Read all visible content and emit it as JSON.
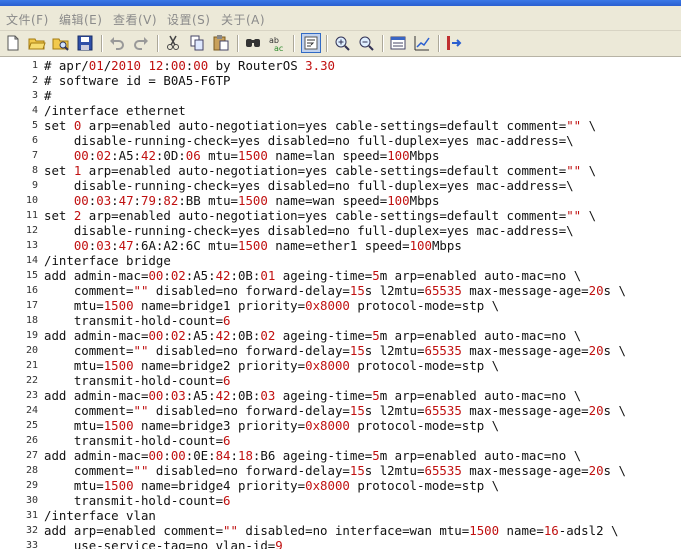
{
  "menu": {
    "items": [
      {
        "label": "文件(F)",
        "name": "menu-file"
      },
      {
        "label": "编辑(E)",
        "name": "menu-edit"
      },
      {
        "label": "查看(V)",
        "name": "menu-view"
      },
      {
        "label": "设置(S)",
        "name": "menu-settings"
      },
      {
        "label": "关于(A)",
        "name": "menu-about"
      }
    ]
  },
  "toolbar": {
    "icons": [
      "new-file-icon",
      "open-folder-icon",
      "browse-icon",
      "save-icon",
      "undo-icon",
      "redo-icon",
      "cut-icon",
      "copy-icon",
      "paste-icon",
      "find-icon",
      "replace-icon",
      "word-wrap-icon",
      "zoom-in-icon",
      "zoom-out-icon",
      "view-list-icon",
      "edit-chart-icon",
      "export-icon"
    ]
  },
  "colors": {
    "number": "#c01010",
    "text": "#111111",
    "menu_text": "#8a8a8a"
  },
  "lines": [
    {
      "n": "1",
      "segs": [
        [
          "# apr/",
          "t"
        ],
        [
          "01",
          "n"
        ],
        [
          "/",
          "t"
        ],
        [
          "2010",
          "n"
        ],
        [
          " ",
          "t"
        ],
        [
          "12",
          "n"
        ],
        [
          ":",
          "t"
        ],
        [
          "00",
          "n"
        ],
        [
          ":",
          "t"
        ],
        [
          "00",
          "n"
        ],
        [
          " by RouterOS ",
          "t"
        ],
        [
          "3.30",
          "n"
        ]
      ]
    },
    {
      "n": "2",
      "segs": [
        [
          "# software id = B0A5-F6TP",
          "t"
        ]
      ]
    },
    {
      "n": "3",
      "segs": [
        [
          "#",
          "t"
        ]
      ]
    },
    {
      "n": "4",
      "segs": [
        [
          "/interface ethernet",
          "t"
        ]
      ]
    },
    {
      "n": "5",
      "segs": [
        [
          "set ",
          "t"
        ],
        [
          "0",
          "n"
        ],
        [
          " arp=enabled auto-negotiation=yes cable-settings=default comment=",
          "t"
        ],
        [
          "\"\"",
          "n"
        ],
        [
          " \\",
          "t"
        ]
      ]
    },
    {
      "n": "6",
      "segs": [
        [
          "    disable-running-check=yes disabled=no full-duplex=yes mac-address=\\",
          "t"
        ]
      ]
    },
    {
      "n": "7",
      "segs": [
        [
          "    ",
          "t"
        ],
        [
          "00",
          "n"
        ],
        [
          ":",
          "t"
        ],
        [
          "02",
          "n"
        ],
        [
          ":A5:",
          "t"
        ],
        [
          "42",
          "n"
        ],
        [
          ":0D:",
          "t"
        ],
        [
          "06",
          "n"
        ],
        [
          " mtu=",
          "t"
        ],
        [
          "1500",
          "n"
        ],
        [
          " name=lan speed=",
          "t"
        ],
        [
          "100",
          "n"
        ],
        [
          "Mbps",
          "t"
        ]
      ]
    },
    {
      "n": "8",
      "segs": [
        [
          "set ",
          "t"
        ],
        [
          "1",
          "n"
        ],
        [
          " arp=enabled auto-negotiation=yes cable-settings=default comment=",
          "t"
        ],
        [
          "\"\"",
          "n"
        ],
        [
          " \\",
          "t"
        ]
      ]
    },
    {
      "n": "9",
      "segs": [
        [
          "    disable-running-check=yes disabled=no full-duplex=yes mac-address=\\",
          "t"
        ]
      ]
    },
    {
      "n": "10",
      "segs": [
        [
          "    ",
          "t"
        ],
        [
          "00",
          "n"
        ],
        [
          ":",
          "t"
        ],
        [
          "03",
          "n"
        ],
        [
          ":",
          "t"
        ],
        [
          "47",
          "n"
        ],
        [
          ":",
          "t"
        ],
        [
          "79",
          "n"
        ],
        [
          ":",
          "t"
        ],
        [
          "82",
          "n"
        ],
        [
          ":BB mtu=",
          "t"
        ],
        [
          "1500",
          "n"
        ],
        [
          " name=wan speed=",
          "t"
        ],
        [
          "100",
          "n"
        ],
        [
          "Mbps",
          "t"
        ]
      ]
    },
    {
      "n": "11",
      "segs": [
        [
          "set ",
          "t"
        ],
        [
          "2",
          "n"
        ],
        [
          " arp=enabled auto-negotiation=yes cable-settings=default comment=",
          "t"
        ],
        [
          "\"\"",
          "n"
        ],
        [
          " \\",
          "t"
        ]
      ]
    },
    {
      "n": "12",
      "segs": [
        [
          "    disable-running-check=yes disabled=no full-duplex=yes mac-address=\\",
          "t"
        ]
      ]
    },
    {
      "n": "13",
      "segs": [
        [
          "    ",
          "t"
        ],
        [
          "00",
          "n"
        ],
        [
          ":",
          "t"
        ],
        [
          "03",
          "n"
        ],
        [
          ":",
          "t"
        ],
        [
          "47",
          "n"
        ],
        [
          ":6A:A2:6C mtu=",
          "t"
        ],
        [
          "1500",
          "n"
        ],
        [
          " name=ether1 speed=",
          "t"
        ],
        [
          "100",
          "n"
        ],
        [
          "Mbps",
          "t"
        ]
      ]
    },
    {
      "n": "14",
      "segs": [
        [
          "/interface bridge",
          "t"
        ]
      ]
    },
    {
      "n": "15",
      "segs": [
        [
          "add admin-mac=",
          "t"
        ],
        [
          "00",
          "n"
        ],
        [
          ":",
          "t"
        ],
        [
          "02",
          "n"
        ],
        [
          ":A5:",
          "t"
        ],
        [
          "42",
          "n"
        ],
        [
          ":0B:",
          "t"
        ],
        [
          "01",
          "n"
        ],
        [
          " ageing-time=",
          "t"
        ],
        [
          "5",
          "n"
        ],
        [
          "m arp=enabled auto-mac=no \\",
          "t"
        ]
      ]
    },
    {
      "n": "16",
      "segs": [
        [
          "    comment=",
          "t"
        ],
        [
          "\"\"",
          "n"
        ],
        [
          " disabled=no forward-delay=",
          "t"
        ],
        [
          "15",
          "n"
        ],
        [
          "s l2mtu=",
          "t"
        ],
        [
          "65535",
          "n"
        ],
        [
          " max-message-age=",
          "t"
        ],
        [
          "20",
          "n"
        ],
        [
          "s \\",
          "t"
        ]
      ]
    },
    {
      "n": "17",
      "segs": [
        [
          "    mtu=",
          "t"
        ],
        [
          "1500",
          "n"
        ],
        [
          " name=bridge1 priority=",
          "t"
        ],
        [
          "0x8000",
          "n"
        ],
        [
          " protocol-mode=stp \\",
          "t"
        ]
      ]
    },
    {
      "n": "18",
      "segs": [
        [
          "    transmit-hold-count=",
          "t"
        ],
        [
          "6",
          "n"
        ]
      ]
    },
    {
      "n": "19",
      "segs": [
        [
          "add admin-mac=",
          "t"
        ],
        [
          "00",
          "n"
        ],
        [
          ":",
          "t"
        ],
        [
          "02",
          "n"
        ],
        [
          ":A5:",
          "t"
        ],
        [
          "42",
          "n"
        ],
        [
          ":0B:",
          "t"
        ],
        [
          "02",
          "n"
        ],
        [
          " ageing-time=",
          "t"
        ],
        [
          "5",
          "n"
        ],
        [
          "m arp=enabled auto-mac=no \\",
          "t"
        ]
      ]
    },
    {
      "n": "20",
      "segs": [
        [
          "    comment=",
          "t"
        ],
        [
          "\"\"",
          "n"
        ],
        [
          " disabled=no forward-delay=",
          "t"
        ],
        [
          "15",
          "n"
        ],
        [
          "s l2mtu=",
          "t"
        ],
        [
          "65535",
          "n"
        ],
        [
          " max-message-age=",
          "t"
        ],
        [
          "20",
          "n"
        ],
        [
          "s \\",
          "t"
        ]
      ]
    },
    {
      "n": "21",
      "segs": [
        [
          "    mtu=",
          "t"
        ],
        [
          "1500",
          "n"
        ],
        [
          " name=bridge2 priority=",
          "t"
        ],
        [
          "0x8000",
          "n"
        ],
        [
          " protocol-mode=stp \\",
          "t"
        ]
      ]
    },
    {
      "n": "22",
      "segs": [
        [
          "    transmit-hold-count=",
          "t"
        ],
        [
          "6",
          "n"
        ]
      ]
    },
    {
      "n": "23",
      "segs": [
        [
          "add admin-mac=",
          "t"
        ],
        [
          "00",
          "n"
        ],
        [
          ":",
          "t"
        ],
        [
          "03",
          "n"
        ],
        [
          ":A5:",
          "t"
        ],
        [
          "42",
          "n"
        ],
        [
          ":0B:",
          "t"
        ],
        [
          "03",
          "n"
        ],
        [
          " ageing-time=",
          "t"
        ],
        [
          "5",
          "n"
        ],
        [
          "m arp=enabled auto-mac=no \\",
          "t"
        ]
      ]
    },
    {
      "n": "24",
      "segs": [
        [
          "    comment=",
          "t"
        ],
        [
          "\"\"",
          "n"
        ],
        [
          " disabled=no forward-delay=",
          "t"
        ],
        [
          "15",
          "n"
        ],
        [
          "s l2mtu=",
          "t"
        ],
        [
          "65535",
          "n"
        ],
        [
          " max-message-age=",
          "t"
        ],
        [
          "20",
          "n"
        ],
        [
          "s \\",
          "t"
        ]
      ]
    },
    {
      "n": "25",
      "segs": [
        [
          "    mtu=",
          "t"
        ],
        [
          "1500",
          "n"
        ],
        [
          " name=bridge3 priority=",
          "t"
        ],
        [
          "0x8000",
          "n"
        ],
        [
          " protocol-mode=stp \\",
          "t"
        ]
      ]
    },
    {
      "n": "26",
      "segs": [
        [
          "    transmit-hold-count=",
          "t"
        ],
        [
          "6",
          "n"
        ]
      ]
    },
    {
      "n": "27",
      "segs": [
        [
          "add admin-mac=",
          "t"
        ],
        [
          "00",
          "n"
        ],
        [
          ":",
          "t"
        ],
        [
          "00",
          "n"
        ],
        [
          ":0E:",
          "t"
        ],
        [
          "84",
          "n"
        ],
        [
          ":",
          "t"
        ],
        [
          "18",
          "n"
        ],
        [
          ":B6 ageing-time=",
          "t"
        ],
        [
          "5",
          "n"
        ],
        [
          "m arp=enabled auto-mac=no \\",
          "t"
        ]
      ]
    },
    {
      "n": "28",
      "segs": [
        [
          "    comment=",
          "t"
        ],
        [
          "\"\"",
          "n"
        ],
        [
          " disabled=no forward-delay=",
          "t"
        ],
        [
          "15",
          "n"
        ],
        [
          "s l2mtu=",
          "t"
        ],
        [
          "65535",
          "n"
        ],
        [
          " max-message-age=",
          "t"
        ],
        [
          "20",
          "n"
        ],
        [
          "s \\",
          "t"
        ]
      ]
    },
    {
      "n": "29",
      "segs": [
        [
          "    mtu=",
          "t"
        ],
        [
          "1500",
          "n"
        ],
        [
          " name=bridge4 priority=",
          "t"
        ],
        [
          "0x8000",
          "n"
        ],
        [
          " protocol-mode=stp \\",
          "t"
        ]
      ]
    },
    {
      "n": "30",
      "segs": [
        [
          "    transmit-hold-count=",
          "t"
        ],
        [
          "6",
          "n"
        ]
      ]
    },
    {
      "n": "31",
      "segs": [
        [
          "/interface vlan",
          "t"
        ]
      ]
    },
    {
      "n": "32",
      "segs": [
        [
          "add arp=enabled comment=",
          "t"
        ],
        [
          "\"\"",
          "n"
        ],
        [
          " disabled=no interface=wan mtu=",
          "t"
        ],
        [
          "1500",
          "n"
        ],
        [
          " name=",
          "t"
        ],
        [
          "16",
          "n"
        ],
        [
          "-adsl2 \\",
          "t"
        ]
      ]
    },
    {
      "n": "33",
      "segs": [
        [
          "    use-service-tag=no vlan-id=",
          "t"
        ],
        [
          "9",
          "n"
        ]
      ]
    }
  ]
}
